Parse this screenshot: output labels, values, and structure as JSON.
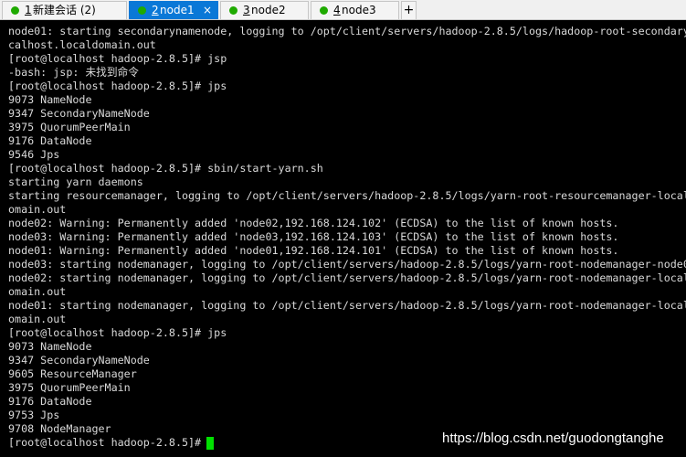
{
  "tabs": [
    {
      "num": "1",
      "label": "新建会话 (2)",
      "active": false
    },
    {
      "num": "2",
      "label": "node1",
      "active": true
    },
    {
      "num": "3",
      "label": "node2",
      "active": false
    },
    {
      "num": "4",
      "label": "node3",
      "active": false
    }
  ],
  "tab_close_glyph": "×",
  "add_tab_label": "+",
  "terminal_lines": [
    "node01: starting secondarynamenode, logging to /opt/client/servers/hadoop-2.8.5/logs/hadoop-root-secondary",
    "calhost.localdomain.out",
    "[root@localhost hadoop-2.8.5]# jsp",
    "-bash: jsp: 未找到命令",
    "[root@localhost hadoop-2.8.5]# jps",
    "9073 NameNode",
    "9347 SecondaryNameNode",
    "3975 QuorumPeerMain",
    "9176 DataNode",
    "9546 Jps",
    "[root@localhost hadoop-2.8.5]# sbin/start-yarn.sh",
    "starting yarn daemons",
    "starting resourcemanager, logging to /opt/client/servers/hadoop-2.8.5/logs/yarn-root-resourcemanager-local",
    "omain.out",
    "node02: Warning: Permanently added 'node02,192.168.124.102' (ECDSA) to the list of known hosts.",
    "node03: Warning: Permanently added 'node03,192.168.124.103' (ECDSA) to the list of known hosts.",
    "node01: Warning: Permanently added 'node01,192.168.124.101' (ECDSA) to the list of known hosts.",
    "node03: starting nodemanager, logging to /opt/client/servers/hadoop-2.8.5/logs/yarn-root-nodemanager-node0",
    "node02: starting nodemanager, logging to /opt/client/servers/hadoop-2.8.5/logs/yarn-root-nodemanager-local",
    "omain.out",
    "node01: starting nodemanager, logging to /opt/client/servers/hadoop-2.8.5/logs/yarn-root-nodemanager-local",
    "omain.out",
    "[root@localhost hadoop-2.8.5]# jps",
    "9073 NameNode",
    "9347 SecondaryNameNode",
    "9605 ResourceManager",
    "3975 QuorumPeerMain",
    "9176 DataNode",
    "9753 Jps",
    "9708 NodeManager",
    "[root@localhost hadoop-2.8.5]# "
  ],
  "watermark": "https://blog.csdn.net/guodongtanghe",
  "colors": {
    "active_tab": "#0a78d7",
    "session_dot": "#1faa00",
    "cursor": "#00e000",
    "terminal_bg": "#000000",
    "terminal_text": "#d9d9d9"
  }
}
